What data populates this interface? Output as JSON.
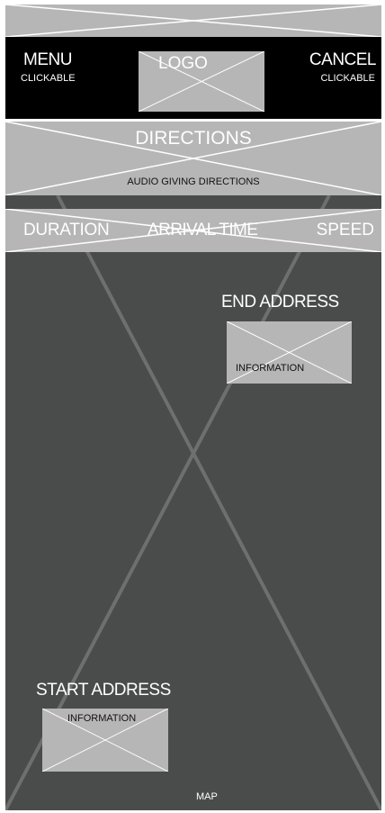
{
  "colors": {
    "map_bg": "#4a4b4b",
    "placeholder_gray": "#b5b6b5",
    "header_bg": "#000000",
    "cross_line": "#ffffff",
    "map_cross_line": "#6e6f6f"
  },
  "header": {
    "menu_label": "MENU",
    "menu_sub": "CLICKABLE",
    "logo_label": "LOGO",
    "cancel_label": "CANCEL",
    "cancel_sub": "CLICKABLE"
  },
  "directions": {
    "title": "DIRECTIONS",
    "subtitle": "AUDIO GIVING DIRECTIONS"
  },
  "stats_bar": {
    "duration": "DURATION",
    "arrival_time": "ARRIVAL TIME",
    "speed": "SPEED"
  },
  "map": {
    "end_address_title": "END ADDRESS",
    "end_address_info": "INFORMATION",
    "start_address_title": "START ADDRESS",
    "start_address_info": "INFORMATION",
    "label": "MAP"
  }
}
